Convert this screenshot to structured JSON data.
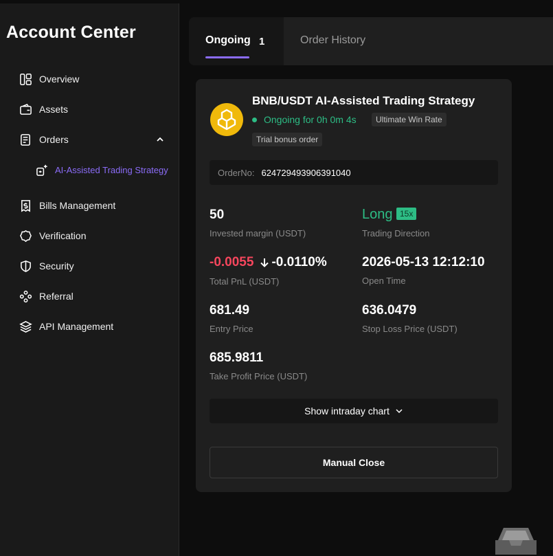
{
  "sidebar": {
    "title": "Account Center",
    "items": [
      {
        "label": "Overview",
        "icon": "overview-icon"
      },
      {
        "label": "Assets",
        "icon": "wallet-icon"
      },
      {
        "label": "Orders",
        "icon": "orders-icon"
      },
      {
        "label": "AI-Assisted Trading Strategy",
        "icon": "ai-strategy-icon"
      },
      {
        "label": "Bills Management",
        "icon": "bills-icon"
      },
      {
        "label": "Verification",
        "icon": "verification-icon"
      },
      {
        "label": "Security",
        "icon": "shield-icon"
      },
      {
        "label": "Referral",
        "icon": "referral-icon"
      },
      {
        "label": "API Management",
        "icon": "layers-icon"
      }
    ],
    "active_color": "#8b6cf7"
  },
  "tabs": {
    "ongoing": {
      "label": "Ongoing",
      "count": "1"
    },
    "history": {
      "label": "Order History"
    }
  },
  "order": {
    "title": "BNB/USDT AI-Assisted Trading Strategy",
    "status": "Ongoing for 0h 0m 4s",
    "tag_win": "Ultimate Win Rate",
    "tag_trial": "Trial bonus order",
    "order_no_label": "OrderNo:",
    "order_no": "624729493906391040",
    "margin": {
      "value": "50",
      "label": "Invested margin (USDT)"
    },
    "direction": {
      "value": "Long",
      "leverage": "15x",
      "label": "Trading Direction"
    },
    "pnl": {
      "value": "-0.0055",
      "pct": "-0.0110%",
      "label": "Total PnL (USDT)"
    },
    "open_time": {
      "value": "2026-05-13 12:12:10",
      "label": "Open Time"
    },
    "entry": {
      "value": "681.49",
      "label": "Entry Price"
    },
    "stop_loss": {
      "value": "636.0479",
      "label": "Stop Loss Price (USDT)"
    },
    "take_profit": {
      "value": "685.9811",
      "label": "Take Profit Price (USDT)"
    },
    "chart_button": "Show intraday chart",
    "close_button": "Manual Close"
  },
  "colors": {
    "positive": "#2dbd85",
    "negative": "#f6465d",
    "coin": "#f0b90b"
  }
}
